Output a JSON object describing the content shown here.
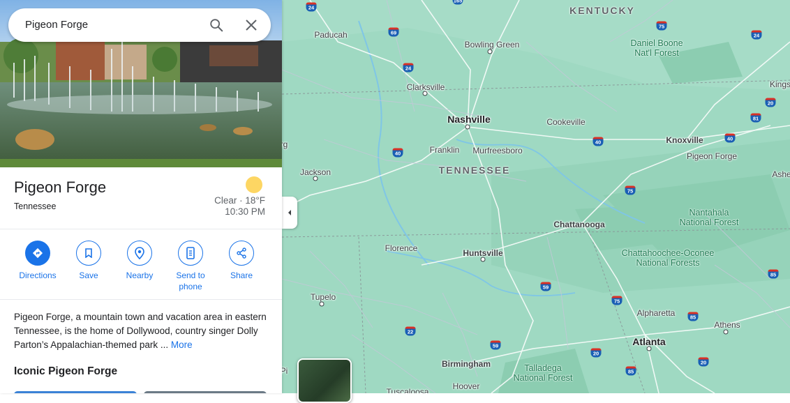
{
  "search": {
    "value": "Pigeon Forge"
  },
  "place": {
    "title": "Pigeon Forge",
    "subtitle": "Tennessee"
  },
  "weather": {
    "condition": "Clear · 18°F",
    "time": "10:30 PM"
  },
  "actions": [
    {
      "label": "Directions",
      "icon": "directions-icon"
    },
    {
      "label": "Save",
      "icon": "bookmark-icon"
    },
    {
      "label": "Nearby",
      "icon": "nearby-icon"
    },
    {
      "label": "Send to\nphone",
      "icon": "send-to-phone-icon"
    },
    {
      "label": "Share",
      "icon": "share-icon"
    }
  ],
  "description": {
    "text": "Pigeon Forge, a mountain town and vacation area in eastern Tennessee, is the home of Dollywood, country singer Dolly Parton’s Appalachian-themed park ...",
    "more": "More"
  },
  "section_title": "Iconic Pigeon Forge",
  "colors": {
    "accent": "#1a73e8",
    "map_land": "#9fd9c2",
    "sun": "#fdd663"
  },
  "map": {
    "states": [
      "KENTUCKY",
      "TENNESSEE"
    ],
    "cities_major": [
      "Nashville",
      "Atlanta"
    ],
    "cities": [
      "Paducah",
      "Bowling Green",
      "Clarksville",
      "Cookeville",
      "Franklin",
      "Murfreesboro",
      "Jackson",
      "Knoxville",
      "Pigeon Forge",
      "Chattanooga",
      "Florence",
      "Huntsville",
      "Tupelo",
      "Alpharetta",
      "Athens",
      "Birmingham",
      "Hoover",
      "Tuscaloosa",
      "Kings",
      "Ashe",
      "rg",
      "Pi"
    ],
    "parks": [
      "Daniel Boone\nNat'l Forest",
      "Nantahala\nNational Forest",
      "Chattahoochee-Oconee\nNational Forests",
      "Talladega\nNational Forest"
    ],
    "shields": [
      "24",
      "69",
      "24",
      "165",
      "75",
      "24",
      "40",
      "40",
      "40",
      "81",
      "75",
      "59",
      "75",
      "22",
      "59",
      "20",
      "85",
      "85",
      "20",
      "85",
      "20"
    ]
  }
}
